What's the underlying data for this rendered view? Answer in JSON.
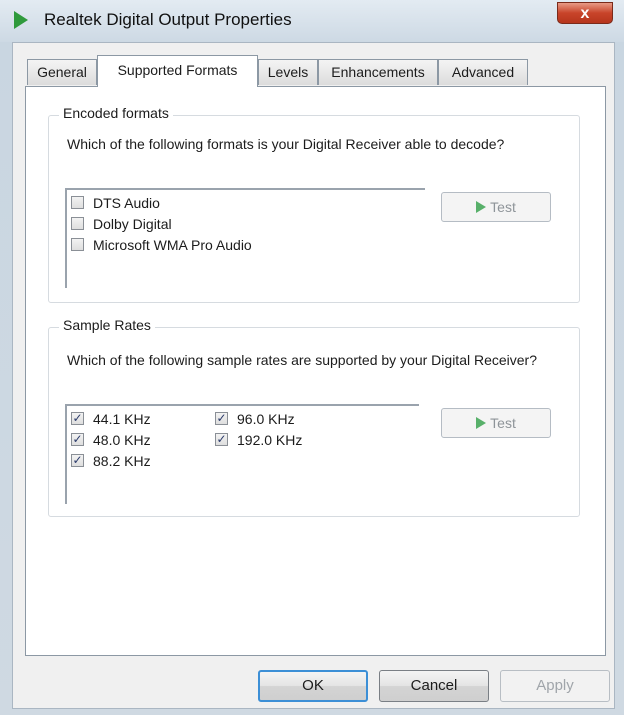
{
  "window": {
    "title": "Realtek Digital Output Properties",
    "close_label": "x"
  },
  "tabs": [
    {
      "label": "General"
    },
    {
      "label": "Supported Formats"
    },
    {
      "label": "Levels"
    },
    {
      "label": "Enhancements"
    },
    {
      "label": "Advanced"
    }
  ],
  "encoded": {
    "title": "Encoded formats",
    "description": "Which of the following formats is your Digital Receiver able to decode?",
    "items": [
      {
        "label": "DTS Audio",
        "checked": false
      },
      {
        "label": "Dolby Digital",
        "checked": false
      },
      {
        "label": "Microsoft WMA Pro Audio",
        "checked": false
      }
    ],
    "test_label": "Test"
  },
  "rates": {
    "title": "Sample Rates",
    "description": "Which of the following sample rates are supported by your Digital Receiver?",
    "col1": [
      {
        "label": "44.1 KHz",
        "checked": true
      },
      {
        "label": "48.0 KHz",
        "checked": true
      },
      {
        "label": "88.2 KHz",
        "checked": true
      }
    ],
    "col2": [
      {
        "label": "96.0 KHz",
        "checked": true
      },
      {
        "label": "192.0 KHz",
        "checked": true
      }
    ],
    "test_label": "Test"
  },
  "buttons": {
    "ok": "OK",
    "cancel": "Cancel",
    "apply": "Apply"
  },
  "colors": {
    "accent": "#3c8fd6",
    "play_icon": "#2f9a3c"
  }
}
